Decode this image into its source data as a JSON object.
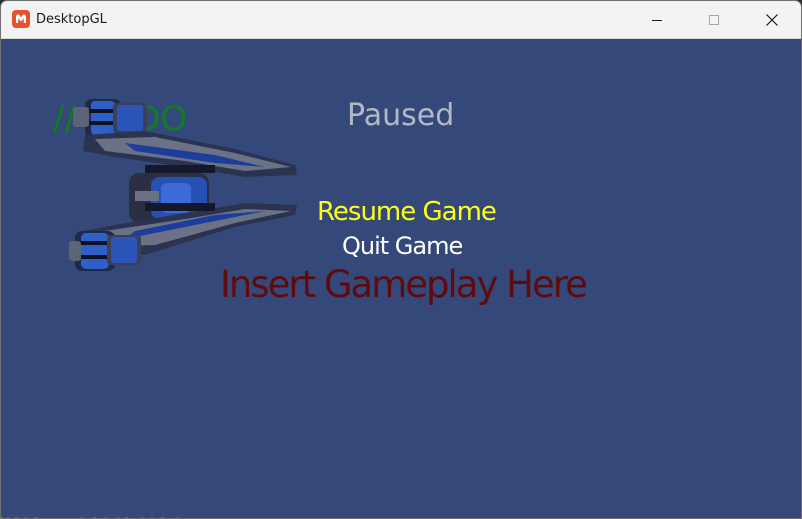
{
  "window": {
    "title": "DesktopGL",
    "app_icon": "monogame-logo-icon",
    "controls": {
      "minimize_icon": "minimize-icon",
      "maximize_icon": "maximize-icon",
      "close_icon": "close-icon"
    }
  },
  "game": {
    "background_color": "#34497a",
    "todo_text": "// TODO",
    "ship_sprite": "spaceship-sprite",
    "gameplay_text": "Insert Gameplay Here",
    "gameplay_color": "#5e0b0e"
  },
  "pause_menu": {
    "title": "Paused",
    "title_color": "#b4b8c6",
    "entries": [
      {
        "label": "Resume Game",
        "selected": true,
        "color": "#ffff14"
      },
      {
        "label": "Quit Game",
        "selected": false,
        "color": "#ffffff"
      }
    ]
  }
}
